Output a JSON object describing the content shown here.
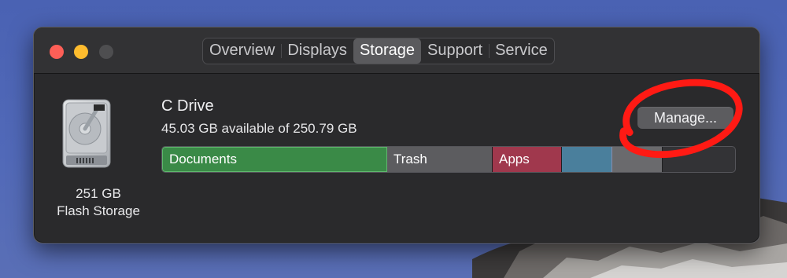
{
  "window": {
    "tabs": [
      {
        "label": "Overview"
      },
      {
        "label": "Displays"
      },
      {
        "label": "Storage"
      },
      {
        "label": "Support"
      },
      {
        "label": "Service"
      }
    ],
    "active_tab": "Storage"
  },
  "disk": {
    "icon": "hard-drive-icon",
    "capacity_label": "251 GB",
    "type_label": "Flash Storage"
  },
  "drive": {
    "name": "C Drive",
    "availability": "45.03 GB available of 250.79 GB",
    "manage_label": "Manage..."
  },
  "storage_bar": {
    "segments": [
      {
        "label": "Documents",
        "color": "#3a8a47"
      },
      {
        "label": "Trash",
        "color": "#5c5c5f"
      },
      {
        "label": "Apps",
        "color": "#a0384d"
      },
      {
        "label": "",
        "color": "#4a7f9c"
      },
      {
        "label": "",
        "color": "#6a6a6d"
      }
    ]
  },
  "colors": {
    "annotation_circle": "#ff1a14",
    "close": "#fe5f57",
    "minimize": "#febc2e"
  }
}
